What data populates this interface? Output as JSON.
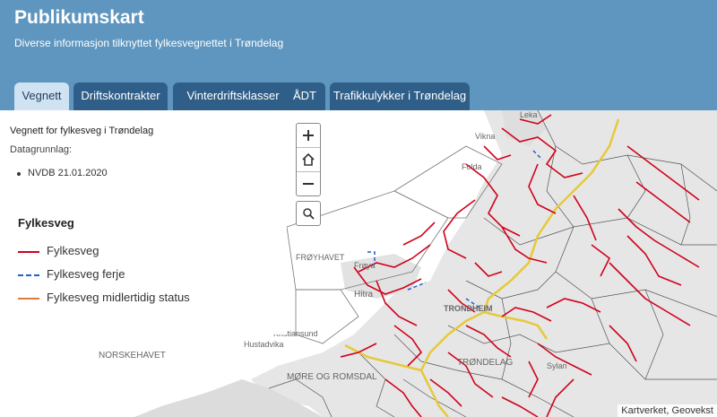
{
  "header": {
    "title": "Publikumskart",
    "subtitle": "Diverse informasjon tilknyttet fylkesvegnettet i Trøndelag"
  },
  "tabs": [
    {
      "label": "Vegnett",
      "active": true
    },
    {
      "label": "Driftskontrakter",
      "active": false
    },
    {
      "label": "Vinterdriftsklasser",
      "active": false
    },
    {
      "label": "ÅDT",
      "active": false
    },
    {
      "label": "Trafikkulykker i Trøndelag",
      "active": false
    }
  ],
  "panel": {
    "heading": "Vegnett for fylkesveg i Trøndelag",
    "data_label": "Datagrunnlag:",
    "data_item": "NVDB 21.01.2020"
  },
  "legend": {
    "title": "Fylkesveg",
    "items": [
      {
        "label": "Fylkesveg",
        "color": "#d0021b",
        "style": "solid"
      },
      {
        "label": "Fylkesveg ferje",
        "color": "#1f5fd1",
        "style": "dashed"
      },
      {
        "label": "Fylkesveg midlertidig status",
        "color": "#e07b39",
        "style": "solid"
      }
    ]
  },
  "map": {
    "labels": {
      "leka": "Leka",
      "vikna": "Vikna",
      "folda": "Folda",
      "froyhavet": "FRØYHAVET",
      "froya": "Frøya",
      "hitra": "Hitra",
      "trondheim": "TRONDHEIM",
      "norskehavet": "NORSKEHAVET",
      "kristiansund": "Kristiansund",
      "hustadvika": "Hustadvika",
      "more_romsdal": "MØRE OG ROMSDAL",
      "trondelag": "TRØNDELAG",
      "sylan": "Sylan"
    },
    "attribution": "Kartverket, Geovekst",
    "colors": {
      "road": "#d0021b",
      "ferry": "#1f5fd1",
      "highway": "#e6c93a",
      "land": "#e8e8e8",
      "sea": "#ffffff"
    }
  },
  "controls": {
    "zoom_in_icon": "plus-icon",
    "home_icon": "home-icon",
    "zoom_out_icon": "minus-icon",
    "search_icon": "search-icon"
  }
}
